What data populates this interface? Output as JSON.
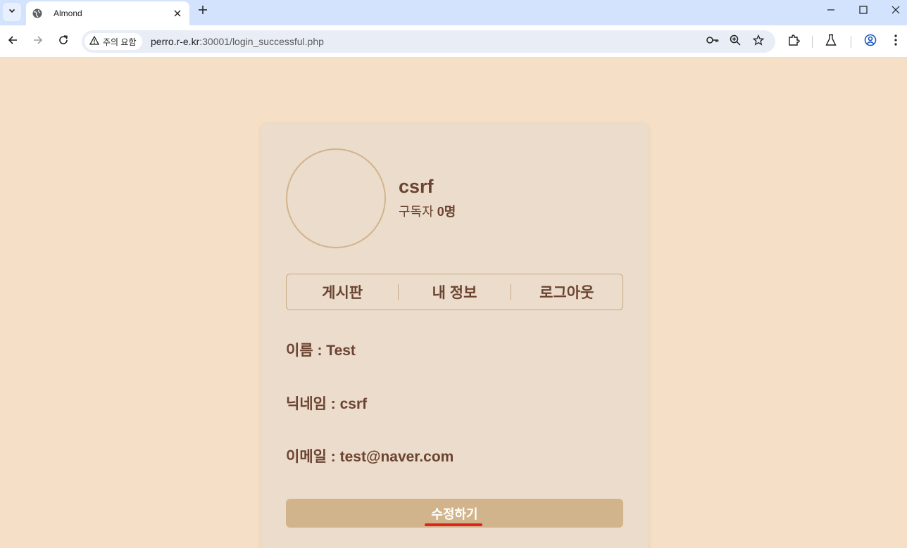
{
  "browser": {
    "tab_title": "Almond",
    "security_chip": "주의 요함",
    "url_host": "perro.r-e.kr",
    "url_rest": ":30001/login_successful.php"
  },
  "profile": {
    "username": "csrf",
    "subscribers_label": "구독자",
    "subscribers_count": "0명"
  },
  "menu": {
    "board": "게시판",
    "my_info": "내 정보",
    "logout": "로그아웃"
  },
  "info": {
    "name": "이름 : Test",
    "nickname": "닉네임 : csrf",
    "email": "이메일 : test@naver.com"
  },
  "edit_button": "수정하기",
  "colors": {
    "page_bg": "#f5dfc6",
    "card_bg": "#ecdccc",
    "accent": "#d2b48c",
    "text": "#6b4431",
    "annotation": "#e0231b"
  }
}
